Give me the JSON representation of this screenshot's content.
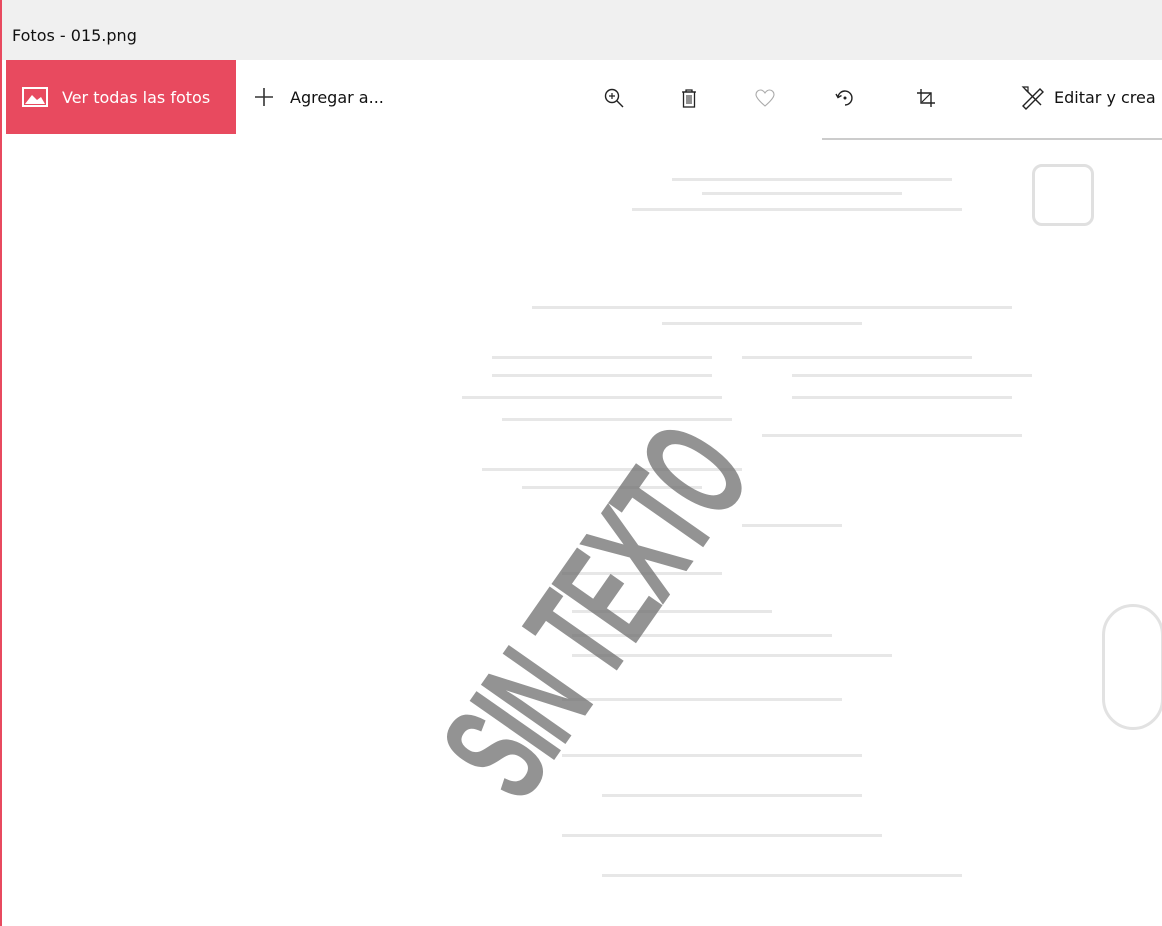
{
  "window": {
    "title": "Fotos - 015.png"
  },
  "toolbar": {
    "all_photos_label": "Ver todas las fotos",
    "add_label": "Agregar a...",
    "edit_label": "Editar y crea"
  },
  "image": {
    "stamp_text": "SIN TEXTO"
  },
  "colors": {
    "accent": "#e84a5f",
    "titlebar_bg": "#f0f0f0"
  }
}
